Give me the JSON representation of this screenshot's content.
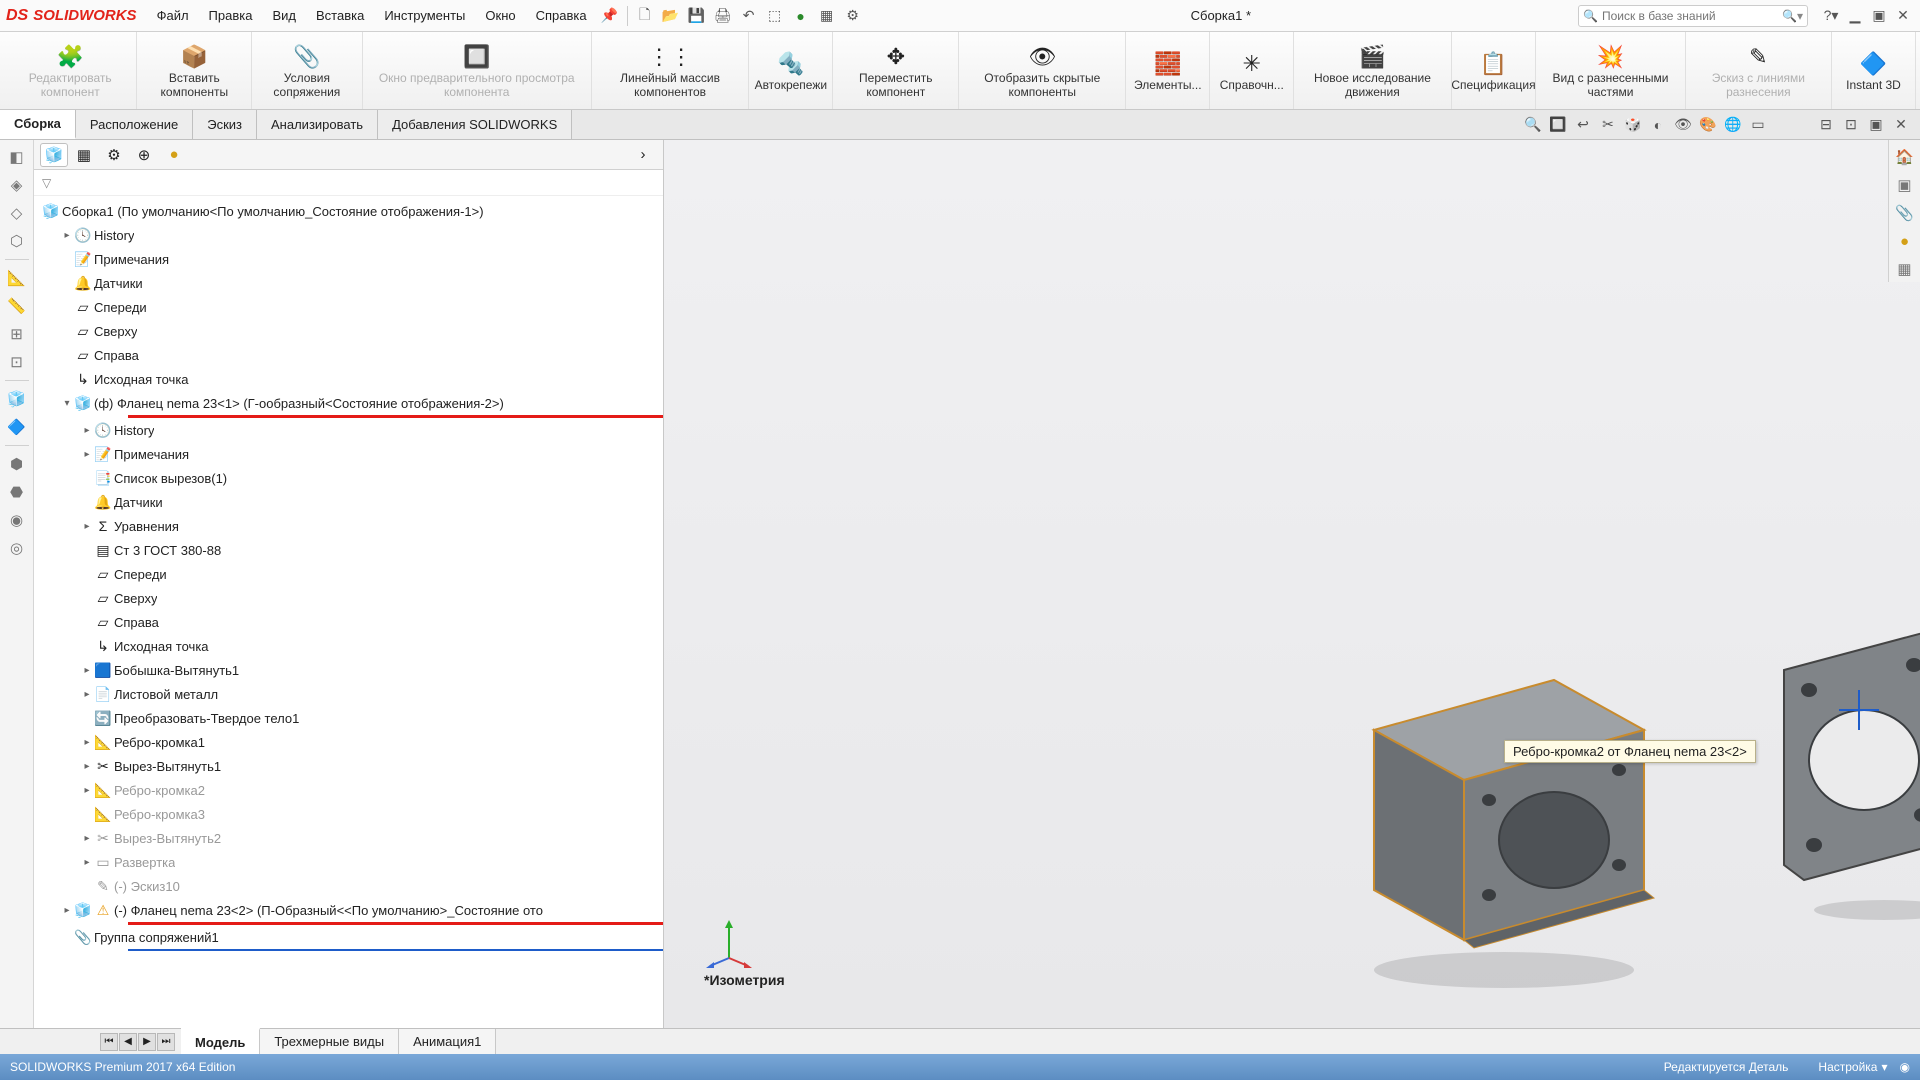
{
  "app": {
    "logo_prefix": "DS",
    "logo_name": "SOLIDWORKS"
  },
  "menu": {
    "file": "Файл",
    "edit": "Правка",
    "view": "Вид",
    "insert": "Вставка",
    "tools": "Инструменты",
    "window": "Окно",
    "help": "Справка"
  },
  "doc_title": "Сборка1 *",
  "search": {
    "placeholder": "Поиск в базе знаний"
  },
  "ribbon": {
    "edit_component": "Редактировать компонент",
    "insert_components": "Вставить компоненты",
    "mate_conditions": "Условия сопряжения",
    "preview_window": "Окно предварительного просмотра компонента",
    "linear_pattern": "Линейный массив компонентов",
    "smart_fasteners": "Автокрепежи",
    "move_component": "Переместить компонент",
    "show_hidden": "Отобразить скрытые компоненты",
    "features": "Элементы...",
    "reference": "Справочн...",
    "motion_study": "Новое исследование движения",
    "bom": "Спецификация",
    "exploded_view": "Вид с разнесенными частями",
    "explode_sketch": "Эскиз с линиями разнесения",
    "instant3d": "Instant 3D"
  },
  "doc_tabs": {
    "assembly": "Сборка",
    "layout": "Расположение",
    "sketch": "Эскиз",
    "analyze": "Анализировать",
    "addins": "Добавления SOLIDWORKS"
  },
  "tree": {
    "root": "Сборка1  (По умолчанию<По умолчанию_Состояние отображения-1>)",
    "history": "History",
    "annotations": "Примечания",
    "sensors": "Датчики",
    "front": "Спереди",
    "top": "Сверху",
    "right": "Справа",
    "origin": "Исходная точка",
    "part1": "(ф) Фланец nema 23<1> (Г-ообразный<Состояние отображения-2>)",
    "p1": {
      "history": "History",
      "annotations": "Примечания",
      "cutlist": "Список вырезов(1)",
      "sensors": "Датчики",
      "equations": "Уравнения",
      "material": "Ст 3 ГОСТ 380-88",
      "front": "Спереди",
      "top": "Сверху",
      "right": "Справа",
      "origin": "Исходная точка",
      "boss": "Бобышка-Вытянуть1",
      "sheetmetal": "Листовой металл",
      "convert": "Преобразовать-Твердое тело1",
      "edgeflange1": "Ребро-кромка1",
      "cut1": "Вырез-Вытянуть1",
      "edgeflange2": "Ребро-кромка2",
      "edgeflange3": "Ребро-кромка3",
      "cut2": "Вырез-Вытянуть2",
      "flatpattern": "Развертка",
      "sketch10": "(-) Эскиз10"
    },
    "part2": "(-) Фланец nema 23<2> (П-Образный<<По умолчанию>_Состояние ото",
    "mates": "Группа сопряжений1"
  },
  "tooltip": "Ребро-кромка2 от Фланец nema 23<2>",
  "view_label": "*Изометрия",
  "bottom_tabs": {
    "model": "Модель",
    "views3d": "Трехмерные виды",
    "anim": "Анимация1"
  },
  "status": {
    "left": "SOLIDWORKS Premium 2017 x64 Edition",
    "mode": "Редактируется Деталь",
    "custom": "Настройка"
  }
}
